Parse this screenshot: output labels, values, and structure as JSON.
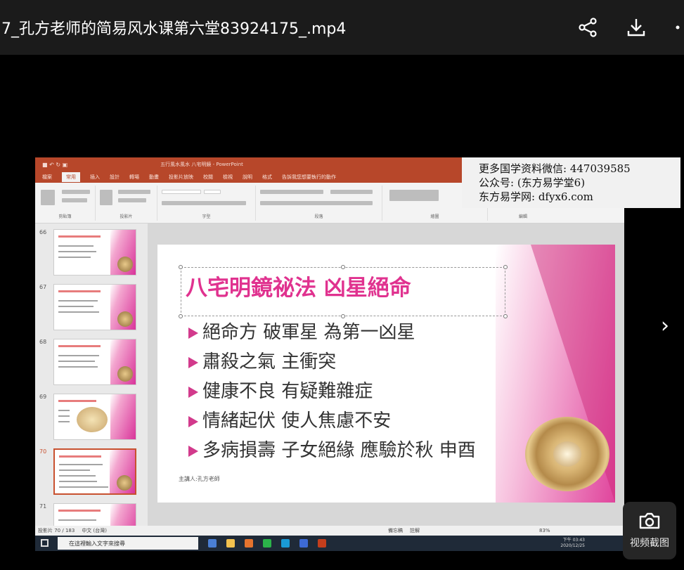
{
  "header": {
    "title": "7_孔方老师的简易风水课第六堂83924175_.mp4",
    "share_icon": "share-icon",
    "download_icon": "download-icon",
    "more_icon": "more-icon"
  },
  "watermark": {
    "line1": "更多国学资料微信: 447039585",
    "line2": "公众号: (东方易学堂6)",
    "line3": "东方易学网: dfyx6.com"
  },
  "ppt": {
    "window_title": "五行風水風水 八宅明鏡 - PowerPoint",
    "tabs": [
      "檔案",
      "常用",
      "插入",
      "設計",
      "轉場",
      "動畫",
      "投影片放映",
      "校閱",
      "檢視",
      "說明",
      "格式",
      "告訴我您想要執行的動作"
    ],
    "active_tab": "常用",
    "ribbon_groups": [
      "剪貼簿",
      "投影片",
      "字型",
      "段落",
      "繪圖",
      "編輯"
    ],
    "thumbnail_numbers": [
      "66",
      "67",
      "68",
      "69",
      "70",
      "71"
    ],
    "selected_thumbnail": "70",
    "slide": {
      "title": "八宅明鏡祕法 凶星絕命",
      "bullets": [
        "絕命方 破軍星 為第一凶星",
        "肅殺之氣 主衝突",
        "健康不良 有疑難雜症",
        "情緒起伏 使人焦慮不安",
        "多病損壽 子女絕緣 應驗於秋 申酉"
      ],
      "footer": "主講人:孔方老師"
    },
    "status": {
      "slide_counter": "投影片 70 / 183",
      "language": "中文 (台灣)",
      "notes": "備忘稿",
      "comments": "註解",
      "zoom": "83%"
    },
    "taskbar": {
      "search_placeholder": "在這裡輸入文字來搜尋",
      "time": "下午 03:43",
      "date": "2020/12/25"
    }
  },
  "next_chevron": "›",
  "capture": {
    "label": "视频截图",
    "icon": "camera-icon"
  },
  "colors": {
    "accent_pink": "#e0328f",
    "ppt_red": "#b7472a"
  }
}
